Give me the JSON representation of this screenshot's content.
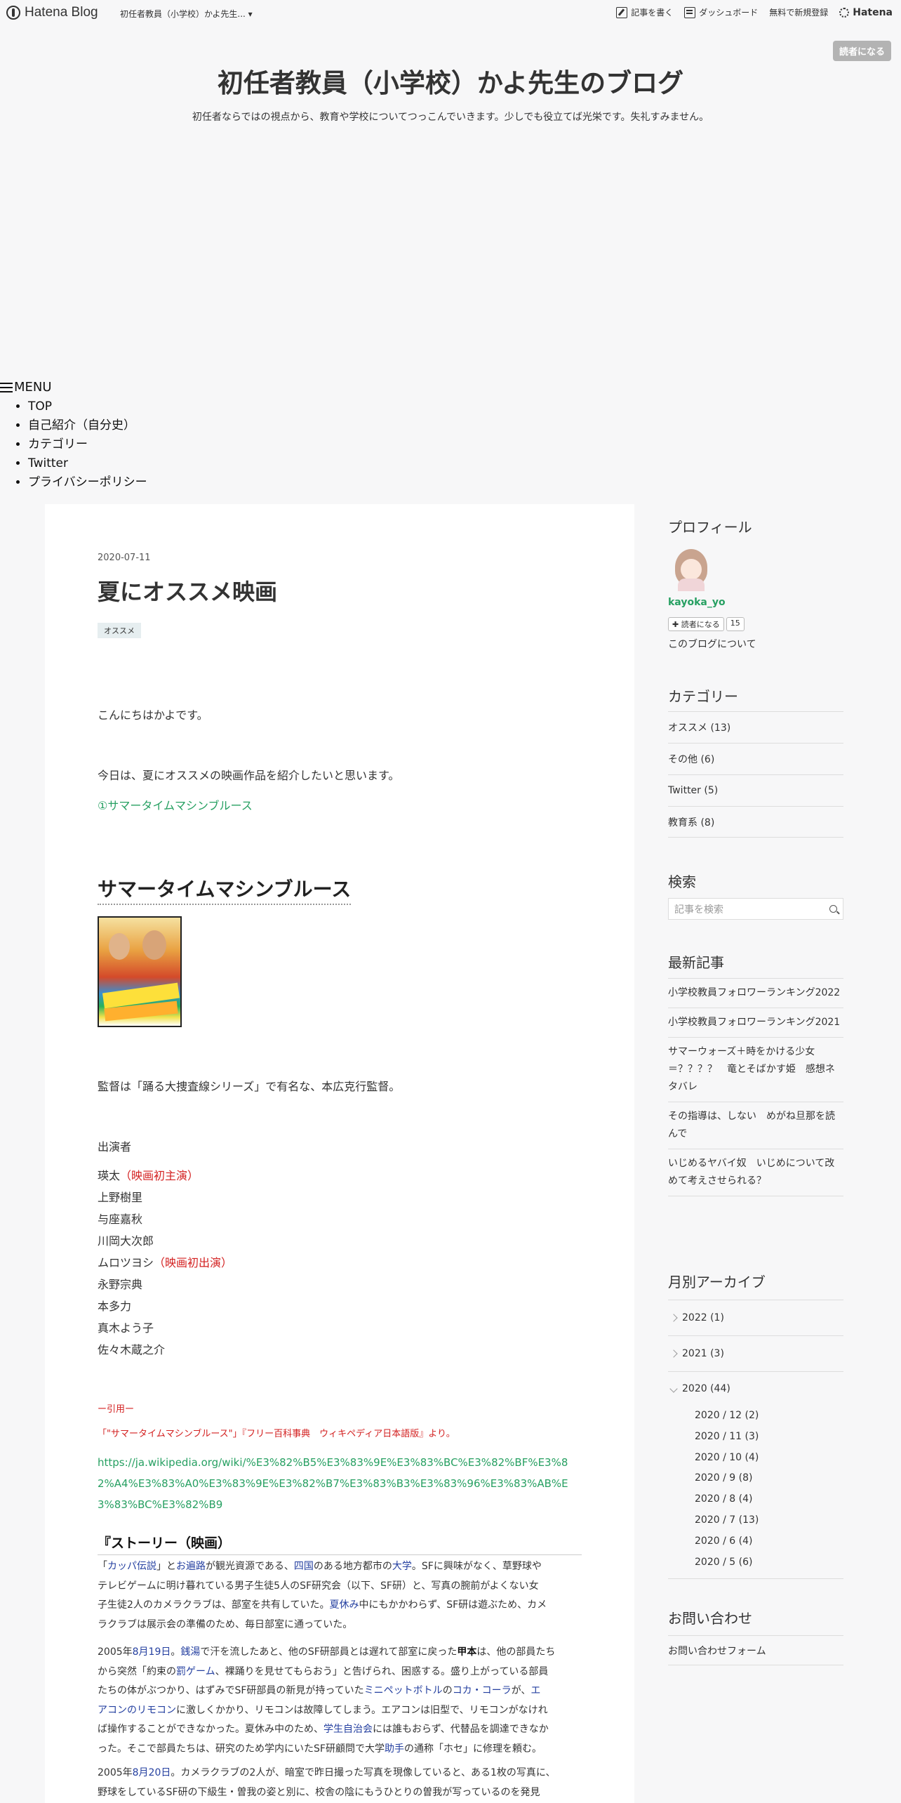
{
  "header": {
    "brand": "Hatena Blog",
    "blog_name_short": "初任者教員（小学校）かよ先生... ▾",
    "write": "記事を書く",
    "dashboard": "ダッシュボード",
    "signup": "無料で新規登録",
    "hatena": "Hatena"
  },
  "subscribe_top": "読者になる",
  "blog": {
    "title": "初任者教員（小学校）かよ先生のブログ",
    "description": "初任者ならではの視点から、教育や学校についてつっこんでいきます。少しでも役立てば光栄です。失礼すみません。"
  },
  "menu": {
    "toggle": "MENU",
    "items": [
      "TOP",
      "自己紹介（自分史）",
      "カテゴリー",
      "Twitter",
      "プライバシーポリシー"
    ]
  },
  "article": {
    "date": "2020-07-11",
    "title": "夏にオススメ映画",
    "tag": "オススメ",
    "greeting": "こんにちはかよです。",
    "intro": "今日は、夏にオススメの映画作品を紹介したいと思います。",
    "toc_link": "①サマータイムマシンブルース",
    "heading": "サマータイムマシンブルース",
    "director": "監督は「踊る大捜査線シリーズ」で有名な、本広克行監督。",
    "cast_label": "出演者",
    "cast": [
      {
        "name": "瑛太",
        "note": "（映画初主演）"
      },
      {
        "name": "上野樹里",
        "note": ""
      },
      {
        "name": "与座嘉秋",
        "note": ""
      },
      {
        "name": "川岡大次郎",
        "note": ""
      },
      {
        "name": "ムロツヨシ",
        "note": "（映画初出演）"
      },
      {
        "name": "永野宗典",
        "note": ""
      },
      {
        "name": "本多力",
        "note": ""
      },
      {
        "name": "真木よう子",
        "note": ""
      },
      {
        "name": "佐々木蔵之介",
        "note": ""
      }
    ],
    "quote_mark": "ー引用ー",
    "quote_source": "「\"サマータイムマシンブルース\"」『フリー百科事典　ウィキペディア日本語版』より。",
    "wiki_url": "https://ja.wikipedia.org/wiki/%E3%82%B5%E3%83%9E%E3%83%BC%E3%82%BF%E3%82%A4%E3%83%A0%E3%83%9E%E3%82%B7%E3%83%B3%E3%83%96%E3%83%AB%E3%83%BC%E3%82%B9",
    "story_heading": "『ストーリー（映画）",
    "story1": {
      "l1": [
        "「",
        "カッパ伝説",
        "」と",
        "お遍路",
        "が観光資源である、",
        "四国",
        "のある地方都市の",
        "大学",
        "。SFに興味がなく、草野球や"
      ],
      "l2": "テレビゲームに明け暮れている男子生徒5人のSF研究会（以下、SF研）と、写真の腕前がよくない女",
      "l3": [
        "子生徒2人のカメラクラブは、部室を共有していた。",
        "夏休み",
        "中にもかかわらず、SF研は遊ぶため、カメ"
      ],
      "l4": "ラクラブは展示会の準備のため、毎日部室に通っていた。"
    },
    "story2": {
      "l1": [
        "2005年",
        "8月19日",
        "。",
        "銭湯",
        "で汗を流したあと、他のSF研部員とは遅れて部室に戻った",
        "甲本",
        "は、他の部員たち"
      ],
      "l2": [
        "から突然「約束の",
        "罰ゲーム",
        "、裸踊りを見せてもらおう」と告げられ、困惑する。盛り上がっている部員"
      ],
      "l3": [
        "たちの体がぶつかり、はずみでSF研部員の新見が持っていた",
        "ミニペットボトル",
        "の",
        "コカ・コーラ",
        "が、",
        "エ"
      ],
      "l4": [
        "アコンのリモコン",
        "に激しくかかり、リモコンは故障してしまう。エアコンは旧型で、リモコンがなけれ"
      ],
      "l5": [
        "ば操作することができなかった。夏休み中のため、",
        "学生自治会",
        "には誰もおらず、代替品を調達できなか"
      ],
      "l6": [
        "った。そこで部員たちは、研究のため学内にいたSF研顧問で大学",
        "助手",
        "の通称「ホセ」に修理を頼む。"
      ]
    },
    "story3": {
      "l1": [
        "2005年",
        "8月20日",
        "。カメラクラブの2人が、暗室で昨日撮った写真を現像していると、ある1枚の写真に、"
      ],
      "l2": "野球をしているSF研の下級生・曽我の姿と別に、校舎の陰にもうひとりの曽我が写っているのを発見"
    }
  },
  "sidebar": {
    "profile_title": "プロフィール",
    "profile_name": "kayoka_yo",
    "subscribe_btn": "✚ 読者になる",
    "subscriber_count": "15",
    "about": "このブログについて",
    "category_title": "カテゴリー",
    "categories": [
      "オススメ (13)",
      "その他 (6)",
      "Twitter (5)",
      "教育系 (8)"
    ],
    "search_title": "検索",
    "search_placeholder": "記事を検索",
    "recent_title": "最新記事",
    "recent": [
      "小学校教員フォロワーランキング2022",
      "小学校教員フォロワーランキング2021",
      "サマーウォーズ＋時をかける少女＝？？？？　竜とそばかす姫　感想ネタバレ",
      "その指導は、しない　めがね旦那を読んで",
      "いじめるヤバイ奴　いじめについて改めて考えさせられる？"
    ],
    "archive_title": "月別アーカイブ",
    "archive_years": [
      "2022 (1)",
      "2021 (3)",
      "2020 (44)"
    ],
    "archive_months": [
      "2020 / 12 (2)",
      "2020 / 11 (3)",
      "2020 / 10 (4)",
      "2020 / 9 (8)",
      "2020 / 8 (4)",
      "2020 / 7 (13)",
      "2020 / 6 (4)",
      "2020 / 5 (6)"
    ],
    "contact_title": "お問い合わせ",
    "contact": "お問い合わせフォーム"
  }
}
